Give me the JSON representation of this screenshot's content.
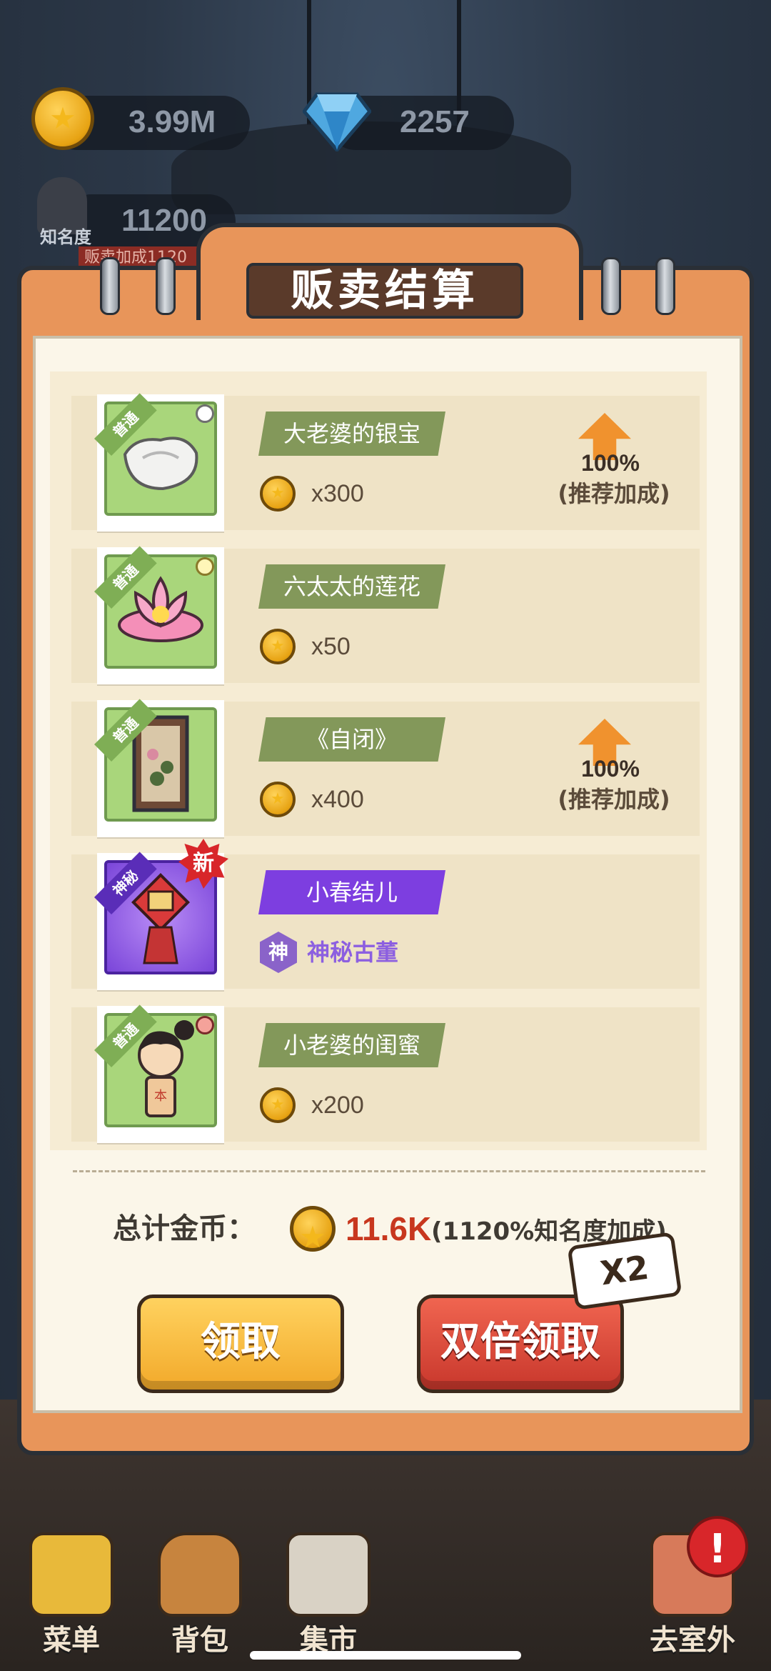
{
  "top": {
    "coins": "3.99M",
    "gems": "2257",
    "fame_label": "知名度",
    "fame_value": "11200",
    "strip_text": "贩卖加成1120"
  },
  "panel": {
    "title": "贩卖结算"
  },
  "items": [
    {
      "rarity": "普通",
      "name": "大老婆的银宝",
      "qty": "x300",
      "bonus_pct": "100%",
      "bonus_label": "(推荐加成)"
    },
    {
      "rarity": "普通",
      "name": "六太太的莲花",
      "qty": "x50"
    },
    {
      "rarity": "普通",
      "name": "《自闭》",
      "qty": "x400",
      "bonus_pct": "100%",
      "bonus_label": "(推荐加成)"
    },
    {
      "rarity": "神秘",
      "name": "小春结儿",
      "badge": "新",
      "hex": "神",
      "subtitle": "神秘古董"
    },
    {
      "rarity": "普通",
      "name": "小老婆的闺蜜",
      "qty": "x200"
    }
  ],
  "total": {
    "label": "总计金币：",
    "value": "11.6K",
    "bonus": "(1120%知名度加成)"
  },
  "buttons": {
    "claim": "领取",
    "double": "双倍领取",
    "x2": "X2"
  },
  "nav": {
    "menu": "菜单",
    "bag": "背包",
    "market": "集市",
    "outside": "去室外",
    "alert": "!"
  },
  "colors": {
    "panel": "#e8955a",
    "name_tag": "#83985a",
    "mystery": "#7d3ee0",
    "total_value": "#c8371e"
  }
}
